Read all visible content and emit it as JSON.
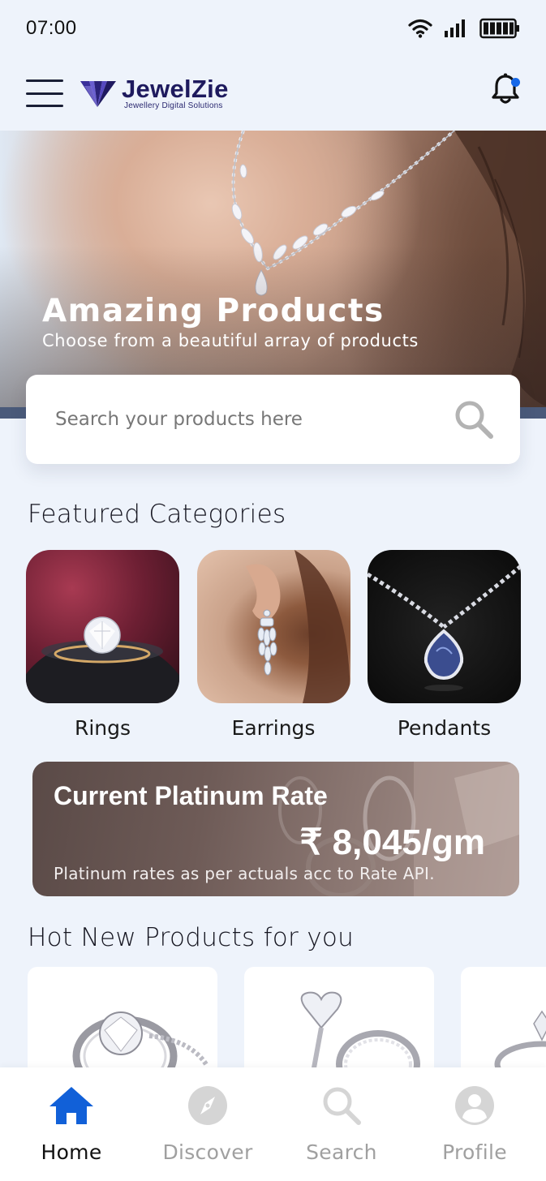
{
  "status_bar": {
    "time": "07:00",
    "icons": [
      "wifi-icon",
      "signal-icon",
      "battery-icon"
    ]
  },
  "header": {
    "brand_name": "JewelZie",
    "brand_tagline": "Jewellery Digital Solutions",
    "icons": [
      "menu-icon",
      "notification-bell-icon"
    ],
    "notification_dot_color": "#1668e8"
  },
  "hero": {
    "title": "Amazing Products",
    "subtitle": "Choose from a beautiful array of products"
  },
  "search": {
    "placeholder": "Search your products here",
    "icon": "search-icon"
  },
  "featured": {
    "title": "Featured Categories",
    "categories": [
      {
        "label": "Rings"
      },
      {
        "label": "Earrings"
      },
      {
        "label": "Pendants"
      }
    ]
  },
  "rate": {
    "title": "Current Platinum Rate",
    "value": "₹ 8,045/gm",
    "note": "Platinum rates as per actuals acc to Rate API."
  },
  "hot_products": {
    "title": "Hot New Products for you"
  },
  "bottom_nav": {
    "active_color": "#1160d8",
    "inactive_color": "#d5d5d5",
    "items": [
      {
        "label": "Home",
        "icon": "home-icon",
        "active": true
      },
      {
        "label": "Discover",
        "icon": "compass-icon",
        "active": false
      },
      {
        "label": "Search",
        "icon": "search-icon",
        "active": false
      },
      {
        "label": "Profile",
        "icon": "profile-icon",
        "active": false
      }
    ]
  }
}
